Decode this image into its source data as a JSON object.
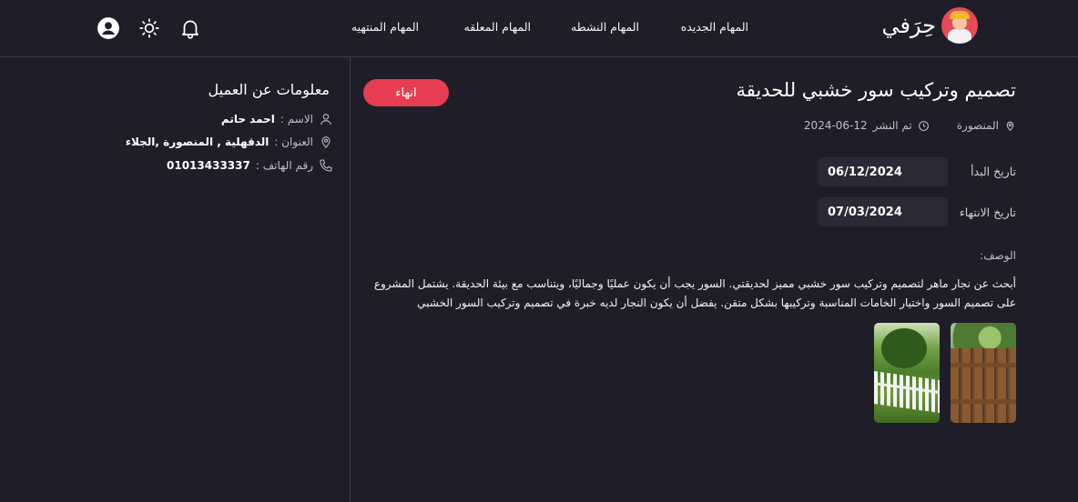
{
  "brand": {
    "name": "حِرَفي"
  },
  "nav": {
    "new_tasks": "المهام الجديده",
    "active_tasks": "المهام النشطه",
    "pending_tasks": "المهام المعلقه",
    "finished_tasks": "المهام المنتهيه"
  },
  "header_icons": [
    "bell-icon",
    "sun-icon",
    "user-avatar-icon"
  ],
  "task": {
    "title": "تصميم وتركيب سور خشبي للحديقة",
    "finish_button": "انهاء",
    "location": "المنصورة",
    "published_label": "تم النشر",
    "published_date": "2024-06-12",
    "start_label": "تاريخ البدأ",
    "start_date": "06/12/2024",
    "end_label": "تاريخ الانتهاء",
    "end_date": "07/03/2024",
    "description_label": "الوصف:",
    "description": "أبحث عن نجار ماهر لتصميم وتركيب سور خشبي مميز لحديقتي. السور يجب أن يكون عمليًا وجماليًا، ويتناسب مع بيئة الحديقة. يشتمل المشروع على تصميم السور واختيار الخامات المناسبة وتركيبها بشكل متقن. يفضل أن يكون النجار لديه خبرة في تصميم وتركيب السور الخشبي"
  },
  "client": {
    "section_title": "معلومات عن العميل",
    "name_label": "الاسم :",
    "name": "احمد حاتم",
    "address_label": "العنوان :",
    "address": "الدقهلية , المنصورة ,الجلاء",
    "phone_label": "رقم الهاتف :",
    "phone": "01013433337"
  },
  "colors": {
    "background": "#1f1e28",
    "accent": "#e63d52",
    "field_bg": "#2a2935"
  }
}
